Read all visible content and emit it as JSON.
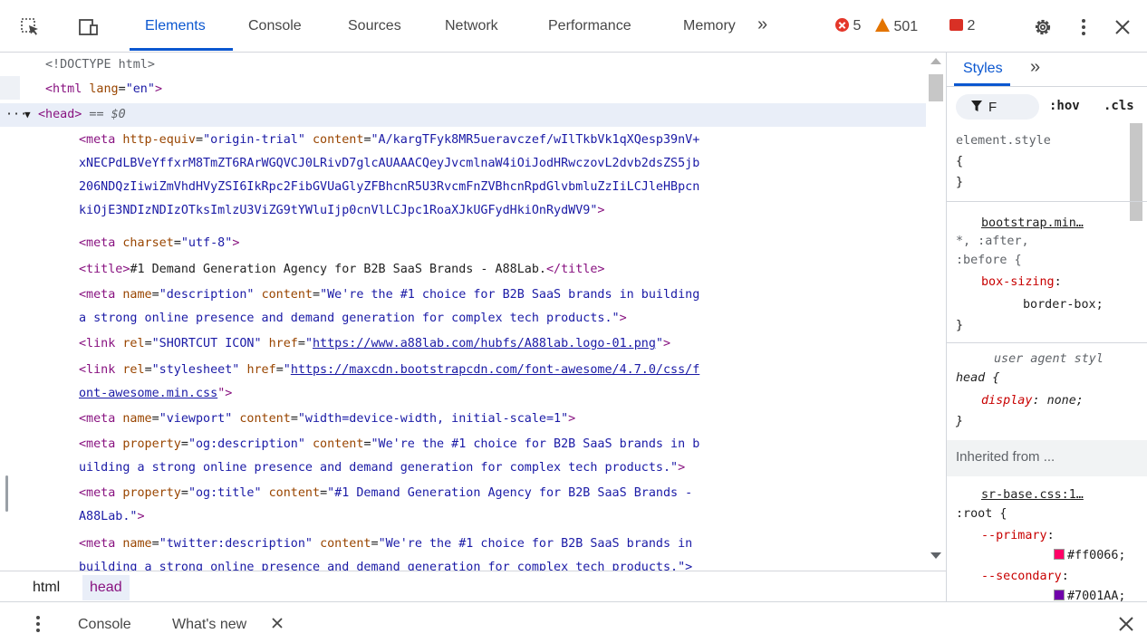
{
  "toolbar": {
    "tabs": [
      "Elements",
      "Console",
      "Sources",
      "Network",
      "Performance",
      "Memory"
    ],
    "more": "»",
    "errors": "5",
    "warnings": "501",
    "issues": "2",
    "icons": [
      "inspect-icon",
      "device-toggle-icon",
      "gear-icon",
      "kebab-menu-icon",
      "close-icon"
    ]
  },
  "tree": {
    "doctype": "<!DOCTYPE html>",
    "html_open": {
      "tag": "<html",
      "attr": "lang",
      "val": "\"en\"",
      "close": ">"
    },
    "head_open": {
      "expander": "···",
      "tag": "<head>",
      "eq": " == ",
      "ref": "$0"
    },
    "l1": {
      "tag": "<meta",
      "a1": "http-equiv",
      "v1": "\"origin-trial\"",
      "a2": "content",
      "v2a": "\"A/kargTFyk8MR5ueravczef/wIlTkbVk1qXQesp39nV+"
    },
    "l1b": "xNECPdLBVeYffxrM8TmZT6RArWGQVCJ0LRivD7glcAUAAACQeyJvcmlnaW4iOiJodHRwczovL2dvb2dsZS5jb",
    "l1c": "206NDQzIiwiZmVhdHVyZSI6IkRpc2FibGVUaGlyZFBhcnR5U3RvcmFnZVBhcnRpdGlvbmluZzIiLCJleHBpcn",
    "l1d": "kiOjE3NDIzNDIzOTksImlzU3ViZG9tYWluIjp0cnVlLCJpc1RoaXJkUGFydHkiOnRydWV9\"",
    "l1d_close": ">",
    "l2": {
      "tag": "<meta",
      "a1": "charset",
      "v1": "\"utf-8\"",
      "close": ">"
    },
    "l3": {
      "tag": "<title>",
      "text": "#1 Demand Generation Agency for B2B SaaS Brands - A88Lab.",
      "end": "</title>"
    },
    "l4": {
      "tag": "<meta",
      "a1": "name",
      "v1": "\"description\"",
      "a2": "content",
      "v2": "\"We're the #1 choice for B2B SaaS brands in building"
    },
    "l4b": "a strong online presence and demand generation for complex tech products.\"",
    "l4b_close": ">",
    "l5": {
      "tag": "<link",
      "a1": "rel",
      "v1": "\"SHORTCUT ICON\"",
      "a2": "href",
      "v2": "https://www.a88lab.com/hubfs/A88lab.logo-01.png",
      "q": "\"",
      "close": ">"
    },
    "l6": {
      "tag": "<link",
      "a1": "rel",
      "v1": "\"stylesheet\"",
      "a2": "href",
      "v2": "https://maxcdn.bootstrapcdn.com/font-awesome/4.7.0/css/f"
    },
    "l6b": "ont-awesome.min.css",
    "l6b_close": "\">",
    "l7": {
      "tag": "<meta",
      "a1": "name",
      "v1": "\"viewport\"",
      "a2": "content",
      "v2": "\"width=device-width, initial-scale=1\"",
      "close": ">"
    },
    "l8": {
      "tag": "<meta",
      "a1": "property",
      "v1": "\"og:description\"",
      "a2": "content",
      "v2": "\"We're the #1 choice for B2B SaaS brands in b"
    },
    "l8b": "uilding a strong online presence and demand generation for complex tech products.\"",
    "l8b_close": ">",
    "l9": {
      "tag": "<meta",
      "a1": "property",
      "v1": "\"og:title\"",
      "a2": "content",
      "v2": "\"#1 Demand Generation Agency for B2B SaaS Brands -"
    },
    "l9b": "A88Lab.\"",
    "l9b_close": ">",
    "l10": {
      "tag": "<meta",
      "a1": "name",
      "v1": "\"twitter:description\"",
      "a2": "content",
      "v2": "\"We're the #1 choice for B2B SaaS brands in"
    },
    "l10b": "building a strong online presence and demand generation for complex tech products.\">"
  },
  "breadcrumb": [
    "html",
    "head"
  ],
  "styles": {
    "tabs": [
      "Styles",
      "»"
    ],
    "filter": "F",
    "hov": ":hov",
    "cls": ".cls",
    "element_style": "element.style",
    "open_brace": "{",
    "close_brace": "}",
    "rule1_source": "bootstrap.min…",
    "rule1_selector_a": "*, :after,",
    "rule1_selector_b": ":before {",
    "rule1_prop": "box-sizing",
    "rule1_val": "border-box;",
    "ua_label": "user agent styl",
    "ua_selector": "head {",
    "ua_prop": "display",
    "ua_val": "none;",
    "inherited": "Inherited from ...",
    "rule2_source": "sr-base.css:1…",
    "rule2_selector": ":root {",
    "var1_prop": "--primary",
    "var1_val": "#ff0066;",
    "var2_prop": "--secondary",
    "var2_val": "#7001AA;",
    "colors": {
      "primary": "#ff0066",
      "secondary": "#7001AA"
    }
  },
  "drawer": {
    "items": [
      "Console",
      "What's new"
    ],
    "icons": [
      "kebab-menu-icon",
      "close-tab-icon",
      "close-drawer-icon"
    ]
  },
  "colors": {
    "accent": "#0b57d0",
    "tag": "#881280",
    "attr": "#994500",
    "value": "#1a1aa6",
    "error": "#e4372a",
    "warning": "#e37400"
  }
}
